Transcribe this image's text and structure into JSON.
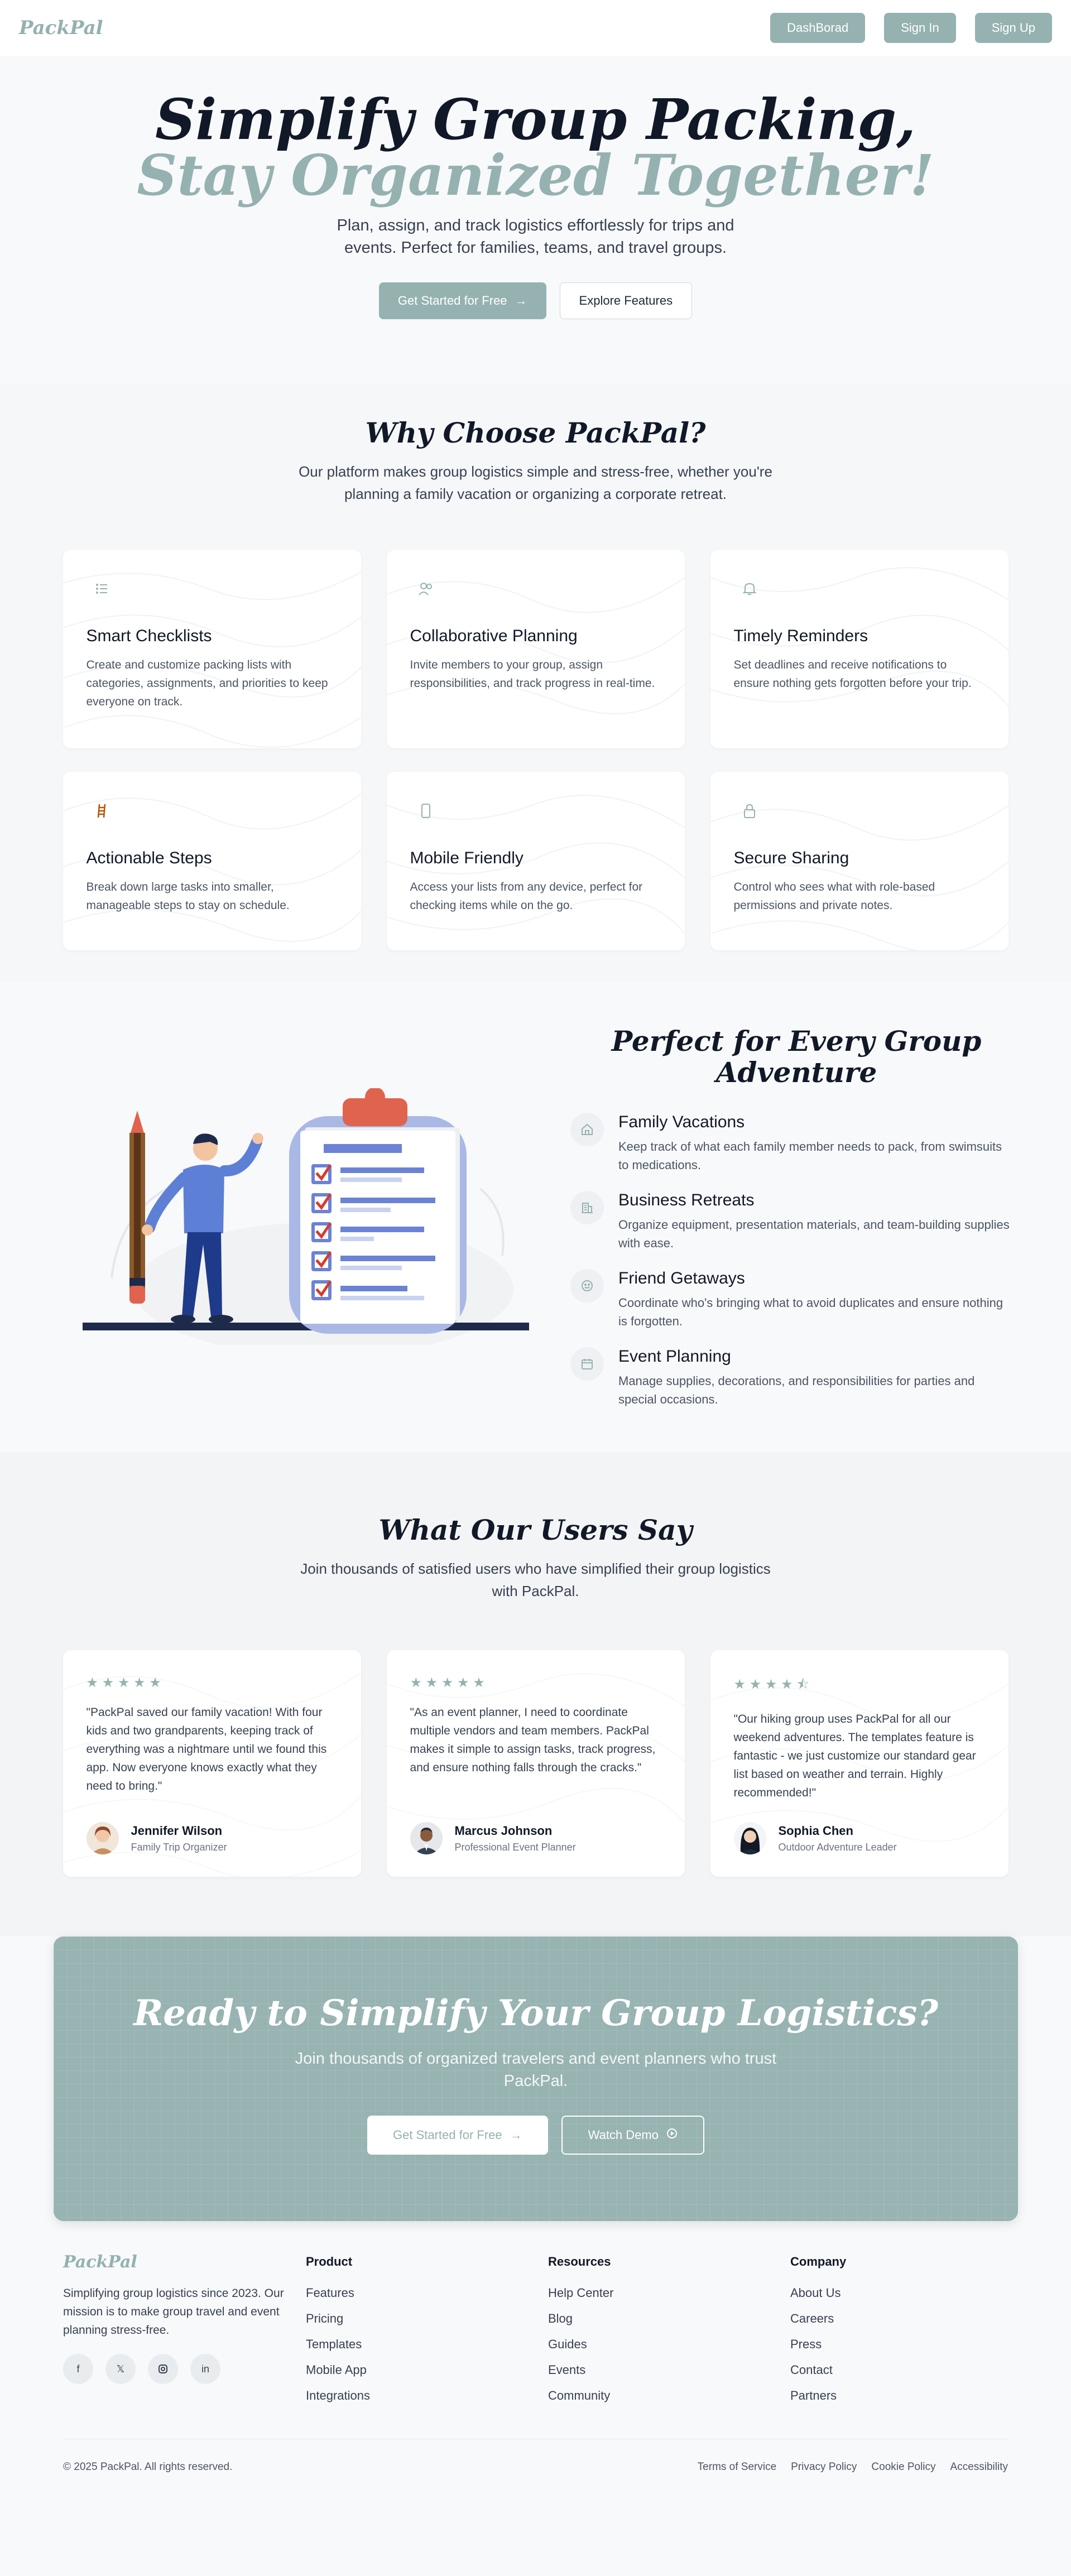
{
  "brand": {
    "name": "PackPal",
    "accent": "#95b2b1"
  },
  "nav": {
    "dashboard": "DashBorad",
    "sign_in": "Sign In",
    "sign_up": "Sign Up"
  },
  "hero": {
    "title_line1": "Simplify Group Packing,",
    "title_line2": "Stay Organized Together!",
    "subtitle": "Plan, assign, and track logistics effortlessly for trips and events. Perfect for families, teams, and travel groups.",
    "primary_cta": "Get Started for Free",
    "secondary_cta": "Explore Features"
  },
  "features": {
    "title": "Why Choose PackPal?",
    "subtitle": "Our platform makes group logistics simple and stress-free, whether you're planning a family vacation or organizing a corporate retreat.",
    "items": [
      {
        "icon": "list-icon",
        "title": "Smart Checklists",
        "desc": "Create and customize packing lists with categories, assignments, and priorities to keep everyone on track."
      },
      {
        "icon": "users-icon",
        "title": "Collaborative Planning",
        "desc": "Invite members to your group, assign responsibilities, and track progress in real-time."
      },
      {
        "icon": "bell-icon",
        "title": "Timely Reminders",
        "desc": "Set deadlines and receive notifications to ensure nothing gets forgotten before your trip."
      },
      {
        "icon": "ladder-icon",
        "title": "Actionable Steps",
        "desc": "Break down large tasks into smaller, manageable steps to stay on schedule."
      },
      {
        "icon": "mobile-icon",
        "title": "Mobile Friendly",
        "desc": "Access your lists from any device, perfect for checking items while on the go."
      },
      {
        "icon": "lock-icon",
        "title": "Secure Sharing",
        "desc": "Control who sees what with role-based permissions and private notes."
      }
    ]
  },
  "perfect": {
    "title": "Perfect for Every Group Adventure",
    "items": [
      {
        "icon": "home-icon",
        "title": "Family Vacations",
        "desc": "Keep track of what each family member needs to pack, from swimsuits to medications."
      },
      {
        "icon": "building-icon",
        "title": "Business Retreats",
        "desc": "Organize equipment, presentation materials, and team-building supplies with ease."
      },
      {
        "icon": "smile-icon",
        "title": "Friend Getaways",
        "desc": "Coordinate who's bringing what to avoid duplicates and ensure nothing is forgotten."
      },
      {
        "icon": "calendar-icon",
        "title": "Event Planning",
        "desc": "Manage supplies, decorations, and responsibilities for parties and special occasions."
      }
    ]
  },
  "testimonials": {
    "title": "What Our Users Say",
    "subtitle": "Join thousands of satisfied users who have simplified their group logistics with PackPal.",
    "items": [
      {
        "rating": 5,
        "stars": "★ ★ ★ ★ ★",
        "quote": "\"PackPal saved our family vacation! With four kids and two grandparents, keeping track of everything was a nightmare until we found this app. Now everyone knows exactly what they need to bring.\"",
        "name": "Jennifer Wilson",
        "role": "Family Trip Organizer"
      },
      {
        "rating": 5,
        "stars": "★ ★ ★ ★ ★",
        "quote": "\"As an event planner, I need to coordinate multiple vendors and team members. PackPal makes it simple to assign tasks, track progress, and ensure nothing falls through the cracks.\"",
        "name": "Marcus Johnson",
        "role": "Professional Event Planner"
      },
      {
        "rating": 4.5,
        "stars": "★ ★ ★ ★ ⯪",
        "quote": "\"Our hiking group uses PackPal for all our weekend adventures. The templates feature is fantastic - we just customize our standard gear list based on weather and terrain. Highly recommended!\"",
        "name": "Sophia Chen",
        "role": "Outdoor Adventure Leader"
      }
    ]
  },
  "cta": {
    "title": "Ready to Simplify Your Group Logistics?",
    "subtitle": "Join thousands of organized travelers and event planners who trust PackPal.",
    "primary": "Get Started for Free",
    "secondary": "Watch Demo"
  },
  "footer": {
    "about": "Simplifying group logistics since 2023. Our mission is to make group travel and event planning stress-free.",
    "socials": [
      "facebook-icon",
      "x-icon",
      "instagram-icon",
      "linkedin-icon"
    ],
    "product": {
      "title": "Product",
      "links": [
        "Features",
        "Pricing",
        "Templates",
        "Mobile App",
        "Integrations"
      ]
    },
    "resources": {
      "title": "Resources",
      "links": [
        "Help Center",
        "Blog",
        "Guides",
        "Events",
        "Community"
      ]
    },
    "company": {
      "title": "Company",
      "links": [
        "About Us",
        "Careers",
        "Press",
        "Contact",
        "Partners"
      ]
    },
    "copyright": "© 2025 PackPal. All rights reserved.",
    "legal": [
      "Terms of Service",
      "Privacy Policy",
      "Cookie Policy",
      "Accessibility"
    ]
  }
}
